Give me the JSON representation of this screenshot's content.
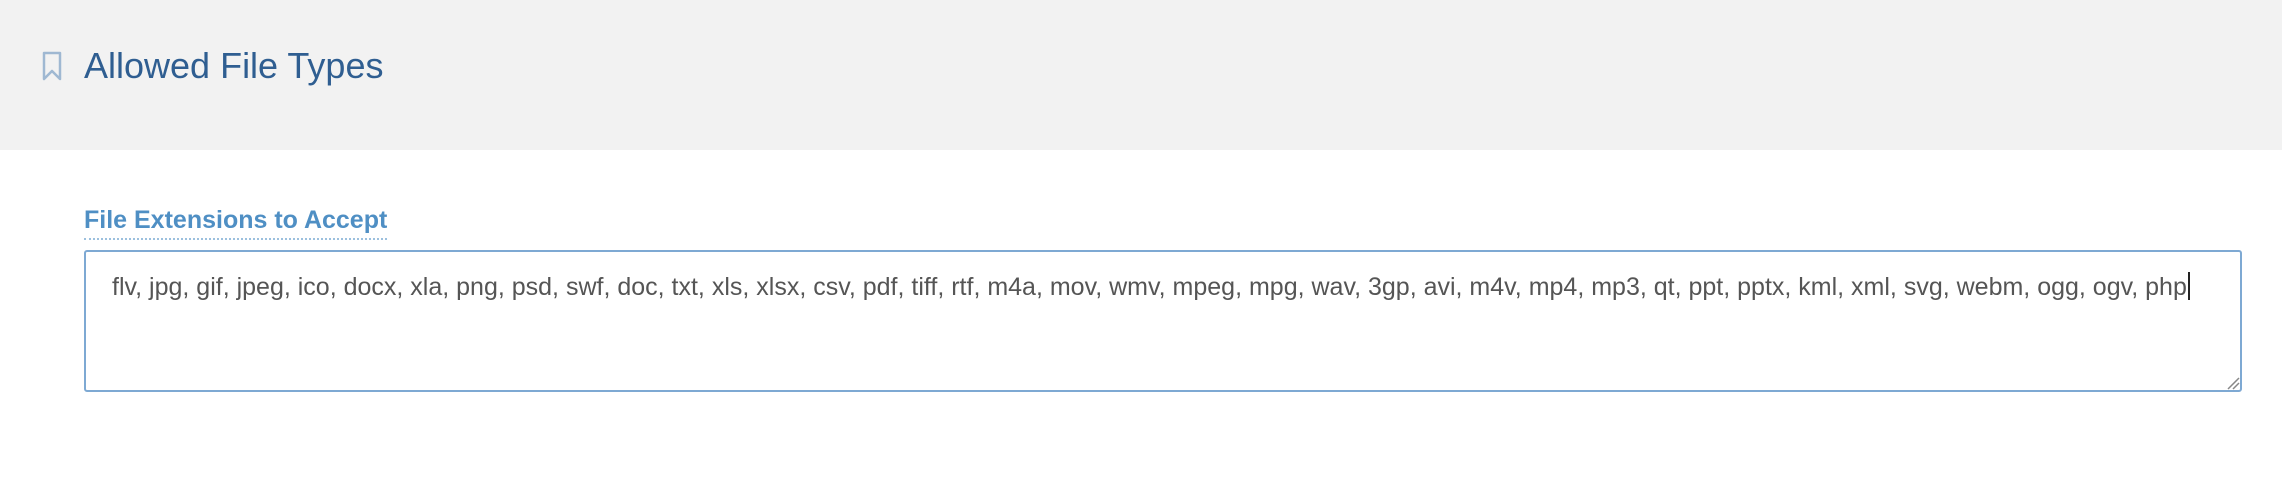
{
  "header": {
    "title": "Allowed File Types",
    "icon": "bookmark-icon"
  },
  "field": {
    "label": "File Extensions to Accept",
    "value": "flv, jpg, gif, jpeg, ico, docx, xla, png, psd, swf, doc, txt, xls, xlsx, csv, pdf, tiff, rtf, m4a, mov, wmv, mpeg, mpg, wav, 3gp, avi, m4v, mp4, mp3, qt, ppt, pptx, kml, xml, svg, webm, ogg, ogv, php"
  },
  "colors": {
    "title": "#2f5e91",
    "label": "#4f8fc4",
    "border": "#7ea9d3",
    "header_bg": "#f2f2f2"
  }
}
